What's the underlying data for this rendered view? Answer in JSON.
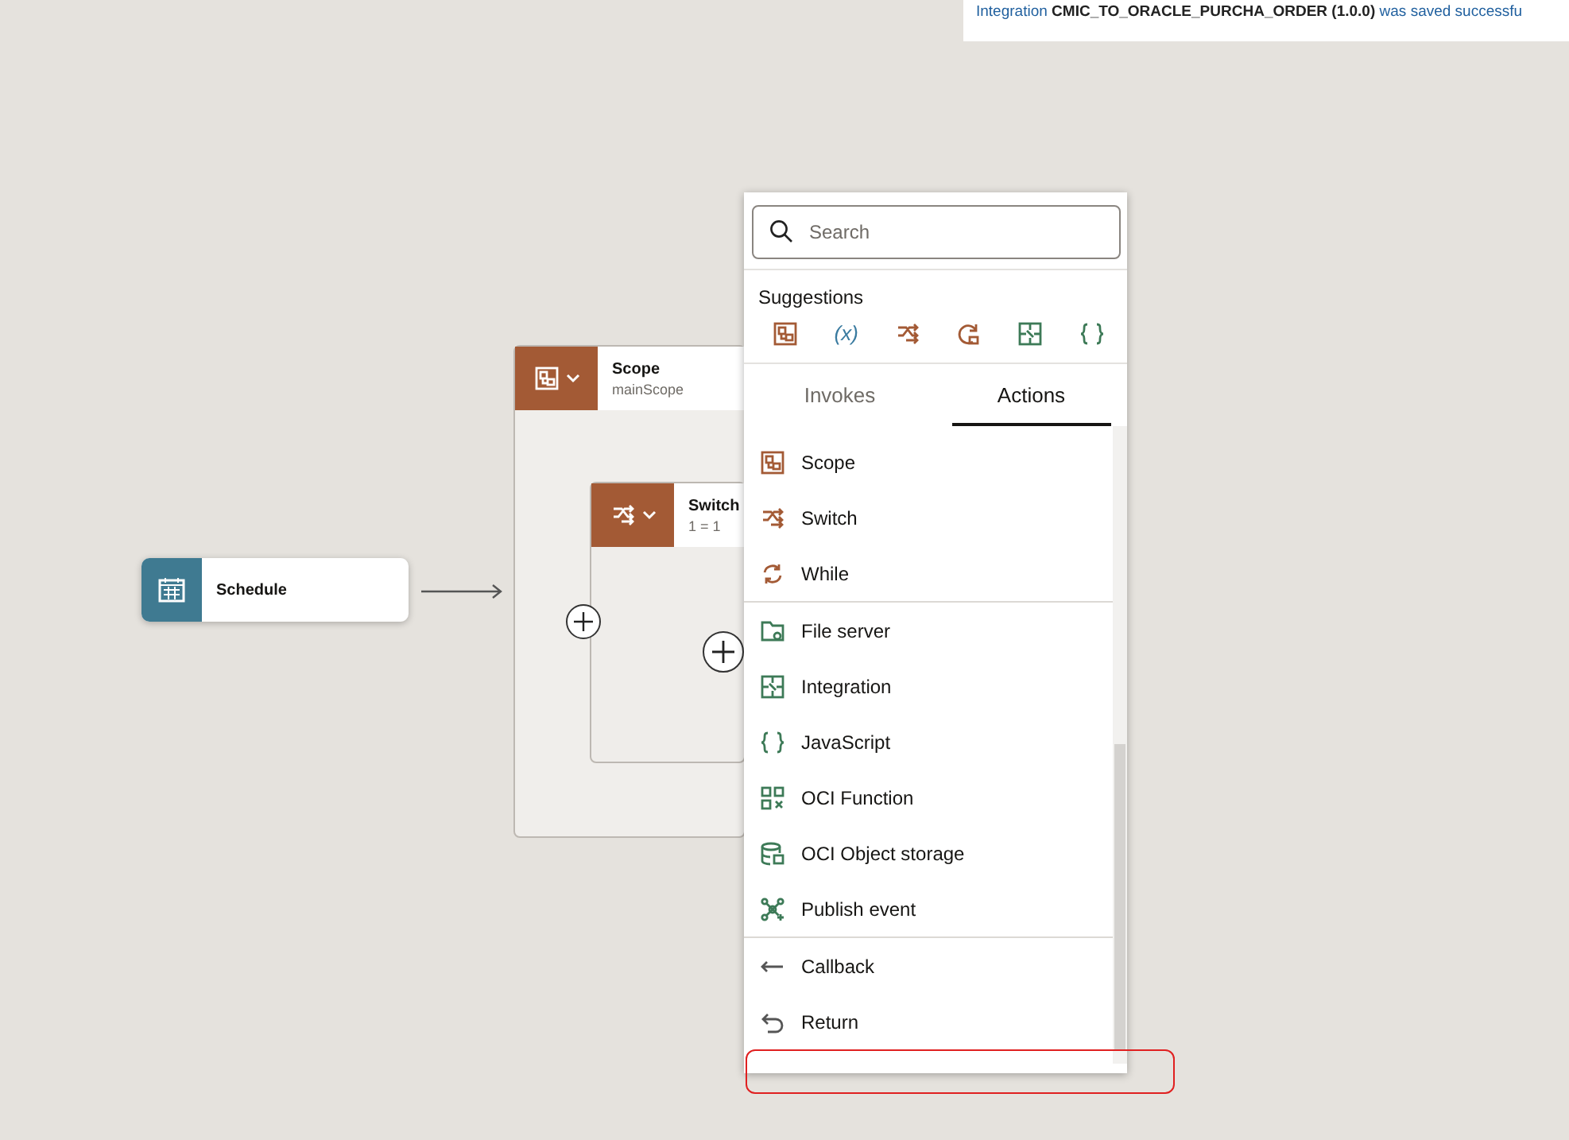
{
  "toast": {
    "message": "Integration **CMIC_TO_ORACLE_PURCHA_ORDER (1.0.0)** was saved successfu"
  },
  "canvas": {
    "trigger": {
      "title": "Schedule"
    },
    "scope": {
      "title": "Scope",
      "subtitle": "mainScope"
    },
    "switch": {
      "title": "Switch",
      "subtitle": "1 = 1"
    }
  },
  "palette": {
    "search": {
      "placeholder": "Search"
    },
    "suggestions_label": "Suggestions",
    "variable_glyph": "(x)",
    "tabs": [
      {
        "label": "Invokes",
        "selected": false
      },
      {
        "label": "Actions",
        "selected": true
      }
    ],
    "groups": [
      [
        {
          "label": "Scope"
        },
        {
          "label": "Switch"
        },
        {
          "label": "While"
        }
      ],
      [
        {
          "label": "File server"
        },
        {
          "label": "Integration"
        },
        {
          "label": "JavaScript"
        },
        {
          "label": "OCI Function"
        },
        {
          "label": "OCI Object storage"
        },
        {
          "label": "Publish event"
        }
      ],
      [
        {
          "label": "Callback"
        },
        {
          "label": "Return"
        }
      ]
    ]
  }
}
